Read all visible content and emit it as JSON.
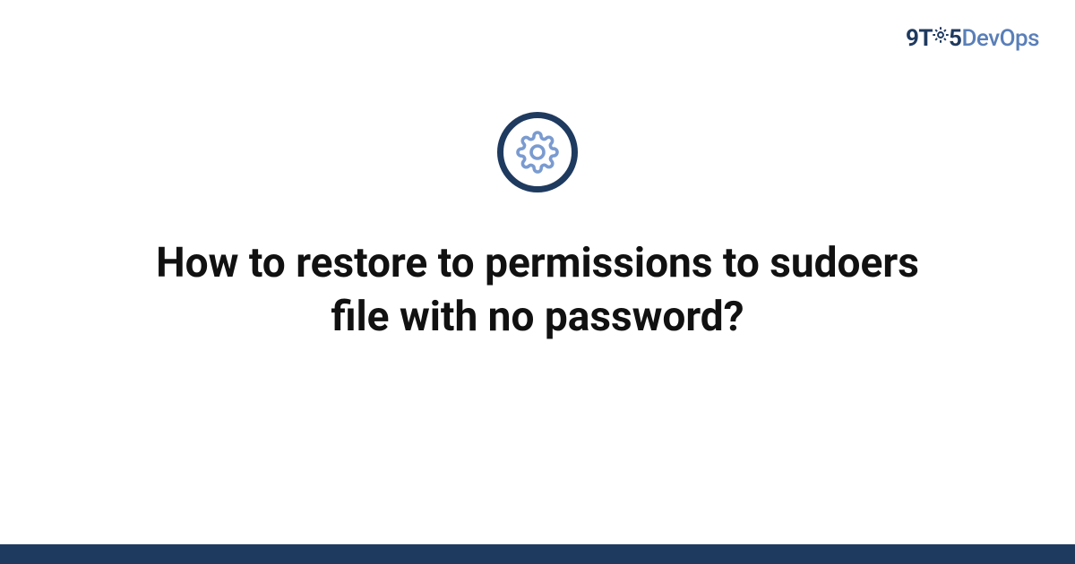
{
  "logo": {
    "prefix": "9T",
    "middle": "5",
    "suffix": "DevOps"
  },
  "icon": {
    "name": "gear-icon"
  },
  "title": "How to restore to permissions to sudoers file with no password?",
  "colors": {
    "brand_dark": "#1f3a5f",
    "brand_light": "#5a7fb8",
    "icon_stroke": "#7a9bd0"
  }
}
